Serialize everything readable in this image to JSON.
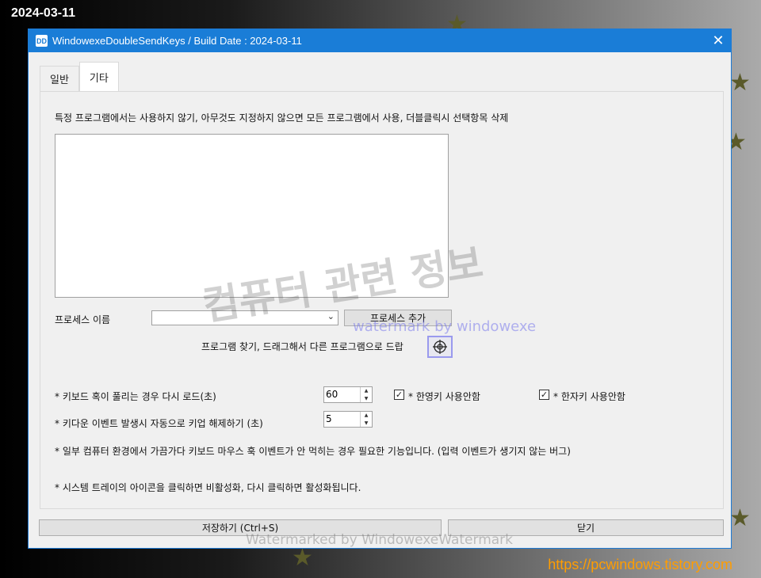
{
  "desktop": {
    "date": "2024-03-11",
    "url": "https://pcwindows.tistory.com"
  },
  "window": {
    "title": "WindowexeDoubleSendKeys / Build Date : 2024-03-11",
    "close_symbol": "✕"
  },
  "tabs": [
    {
      "label": "일반",
      "active": false
    },
    {
      "label": "기타",
      "active": true
    }
  ],
  "panel": {
    "description": "특정 프로그램에서는 사용하지 않기, 아무것도 지정하지 않으면 모든 프로그램에서 사용, 더블클릭시 선택항목 삭제",
    "process_label": "프로세스 이름",
    "process_value": "",
    "add_process_button": "프로세스 추가",
    "find_program_label": "프로그램 찾기, 드래그해서 다른 프로그램으로 드랍",
    "reload_label": "* 키보드 혹이 풀리는 경우 다시 로드(초)",
    "reload_value": "60",
    "keyup_label": "* 키다운 이벤트 발생시 자동으로 키업 해제하기 (초)",
    "keyup_value": "5",
    "hangul_checkbox_label": "* 한영키 사용안함",
    "hangul_checked": true,
    "hanja_checkbox_label": "* 한자키 사용안함",
    "hanja_checked": true,
    "note1": "* 일부 컴퓨터 환경에서 가끔가다 키보드 마우스 훅 이벤트가 안 먹히는 경우 필요한 기능입니다. (입력 이벤트가 생기지 않는 버그)",
    "note2": "* 시스템 트레이의 아이콘을 클릭하면 비활성화, 다시 클릭하면 활성화됩니다."
  },
  "buttons": {
    "save": "저장하기 (Ctrl+S)",
    "close": "닫기"
  },
  "watermarks": {
    "korean": "컴퓨터 관련 정보",
    "blue": "watermark by windowexe",
    "bottom": "Watermarked by WindowexeWatermark"
  },
  "colors": {
    "titlebar": "#1a7dd7",
    "url": "#ff9d00"
  }
}
